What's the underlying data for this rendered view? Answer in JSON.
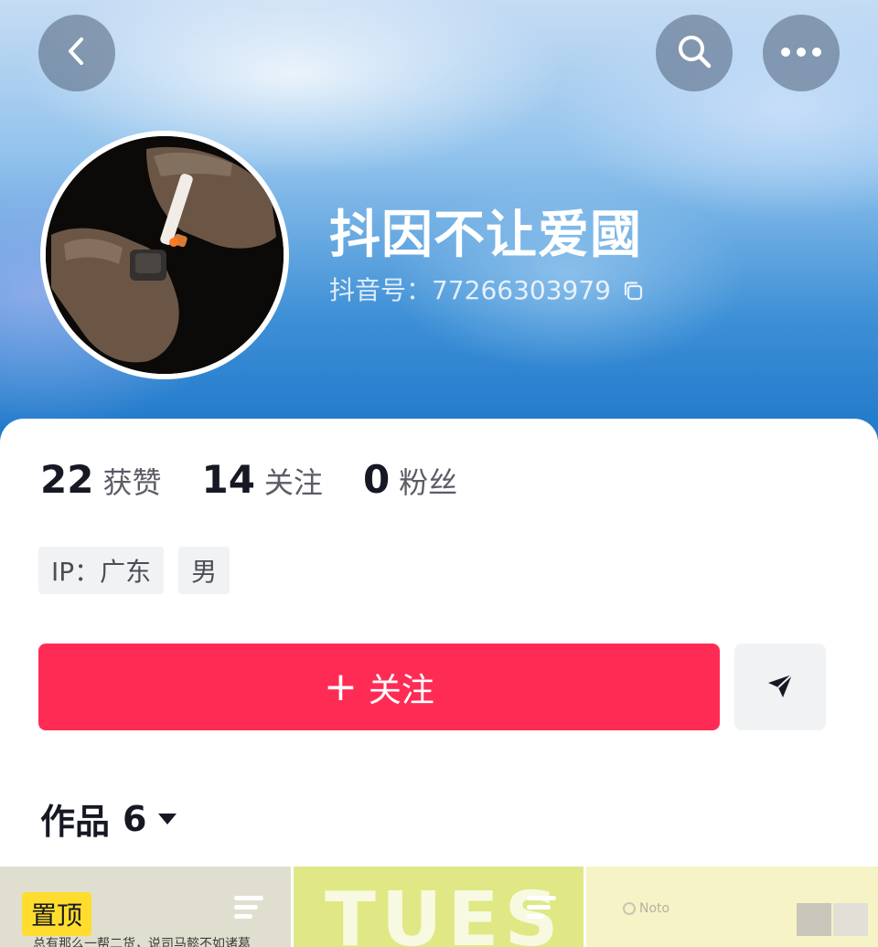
{
  "header": {
    "back_icon": "chevron-left-icon",
    "search_icon": "search-icon",
    "more_icon": "more-dots-icon"
  },
  "profile": {
    "nickname": "抖因不让爱國",
    "douyin_id": "抖音号：77266303979",
    "copy_icon": "copy-icon",
    "avatar_description": "avatar"
  },
  "stats": [
    {
      "value": "22",
      "label": "获赞"
    },
    {
      "value": "14",
      "label": "关注"
    },
    {
      "value": "0",
      "label": "粉丝"
    }
  ],
  "tags": [
    {
      "label": "IP：广东"
    },
    {
      "label": "男"
    }
  ],
  "actions": {
    "follow_plus": "+",
    "follow_label": "关注",
    "share_icon": "send-icon"
  },
  "works": {
    "label": "作品",
    "count": "6",
    "caret_icon": "caret-down-icon"
  },
  "thumbnails": [
    {
      "badge": "置顶",
      "caption": "总有那么一帮二货，说司马懿不如诸葛",
      "menu_icon": "list-icon"
    },
    {
      "big_text": "TUES",
      "menu_icon": "list-icon"
    },
    {
      "note": "Noto"
    }
  ],
  "colors": {
    "accent": "#fe2c55",
    "text_primary": "#161823",
    "text_secondary": "#5b5c66",
    "tag_bg": "#f1f2f4",
    "pinned_badge": "#ffdd2e"
  }
}
